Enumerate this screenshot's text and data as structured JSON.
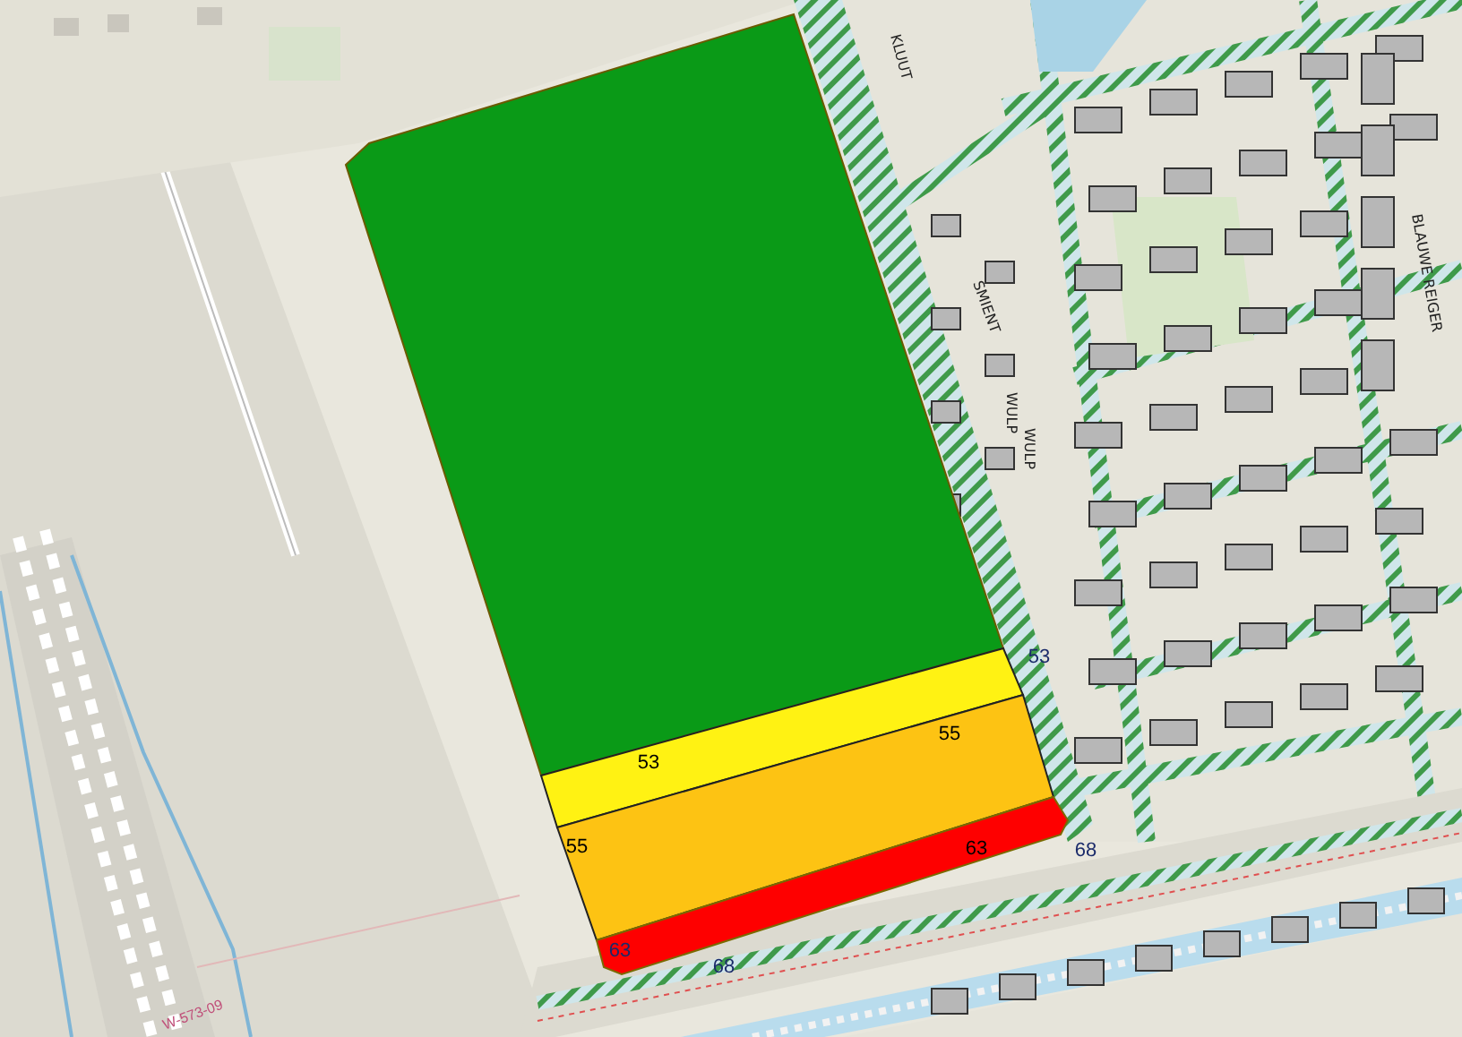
{
  "noise_zones": [
    {
      "color": "#0a9a17"
    },
    {
      "color": "#fff213"
    },
    {
      "color": "#fdc313"
    },
    {
      "color": "#fe0000"
    }
  ],
  "contour_labels": [
    {
      "text": "53",
      "color": "#000000"
    },
    {
      "text": "55",
      "color": "#000000"
    },
    {
      "text": "55",
      "color": "#000000"
    },
    {
      "text": "63",
      "color": "#000000"
    },
    {
      "text": "63",
      "color": "#1a2a6a"
    },
    {
      "text": "68",
      "color": "#1a2a6a"
    },
    {
      "text": "53",
      "color": "#1a2a6a"
    },
    {
      "text": "68",
      "color": "#1a2a6a"
    }
  ],
  "street_labels": [
    {
      "text": "KLUUT"
    },
    {
      "text": "SMIENT"
    },
    {
      "text": "WULP"
    },
    {
      "text": "WULP"
    },
    {
      "text": "BLAUWE REIGER"
    }
  ],
  "parcel_label": "W-573-09"
}
